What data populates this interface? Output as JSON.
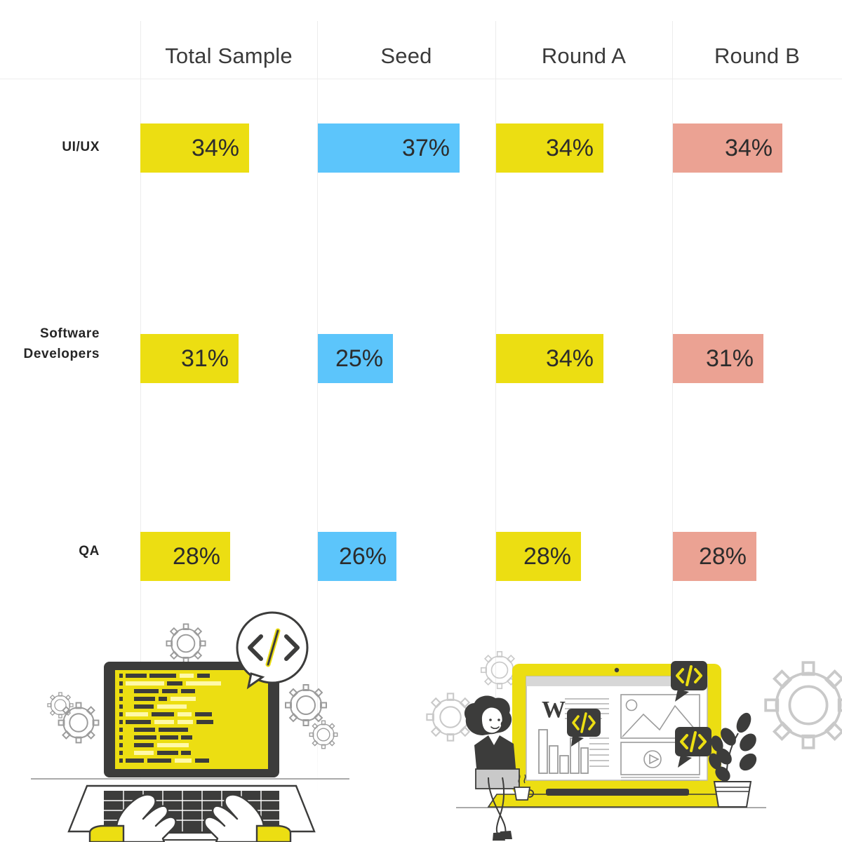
{
  "chart_data": {
    "type": "bar",
    "title": "",
    "xlabel": "",
    "ylabel": "",
    "orientation": "horizontal",
    "grid": "vertical-column-dividers",
    "legend": "none",
    "categories": [
      "UI/UX",
      "Software Developers",
      "QA"
    ],
    "columns": [
      "Total Sample",
      "Seed",
      "Round A",
      "Round B"
    ],
    "column_colors": [
      "#ecde12",
      "#5cc5fb",
      "#ecde12",
      "#eba293"
    ],
    "series": [
      {
        "name": "Total Sample",
        "color": "#ecde12",
        "values": [
          34,
          31,
          28
        ],
        "labels": [
          "34%",
          "31%",
          "28%"
        ]
      },
      {
        "name": "Seed",
        "color": "#5cc5fb",
        "values": [
          37,
          25,
          26
        ],
        "labels": [
          "37%",
          "25%",
          "26%"
        ]
      },
      {
        "name": "Round A",
        "color": "#ecde12",
        "values": [
          34,
          34,
          28
        ],
        "labels": [
          "34%",
          "34%",
          "28%"
        ]
      },
      {
        "name": "Round B",
        "color": "#eba293",
        "values": [
          34,
          31,
          28
        ],
        "labels": [
          "34%",
          "31%",
          "28%"
        ]
      }
    ]
  },
  "header": {
    "columns": [
      {
        "label": "Total Sample"
      },
      {
        "label": "Seed"
      },
      {
        "label": "Round A"
      },
      {
        "label": "Round B"
      }
    ]
  },
  "rows": [
    {
      "label_line1": "UI/UX",
      "label_line2": "",
      "cells": [
        {
          "value": "34%",
          "color": "#ecde12"
        },
        {
          "value": "37%",
          "color": "#5cc5fb"
        },
        {
          "value": "34%",
          "color": "#ecde12"
        },
        {
          "value": "34%",
          "color": "#eba293"
        }
      ]
    },
    {
      "label_line1": "Software",
      "label_line2": "Developers",
      "cells": [
        {
          "value": "31%",
          "color": "#ecde12"
        },
        {
          "value": "25%",
          "color": "#5cc5fb"
        },
        {
          "value": "34%",
          "color": "#ecde12"
        },
        {
          "value": "31%",
          "color": "#eba293"
        }
      ]
    },
    {
      "label_line1": "QA",
      "label_line2": "",
      "cells": [
        {
          "value": "28%",
          "color": "#ecde12"
        },
        {
          "value": "26%",
          "color": "#5cc5fb"
        },
        {
          "value": "28%",
          "color": "#ecde12"
        },
        {
          "value": "28%",
          "color": "#eba293"
        }
      ]
    }
  ],
  "illustrations": {
    "left": {
      "name": "coding-laptop-hands-illustration"
    },
    "right": {
      "name": "woman-web-development-laptop-illustration"
    }
  },
  "colors": {
    "yellow": "#ecde12",
    "blue": "#5cc5fb",
    "salmon": "#eba293",
    "dark": "#3c3c3b",
    "grid": "#ececec",
    "background": "#ffffff"
  }
}
